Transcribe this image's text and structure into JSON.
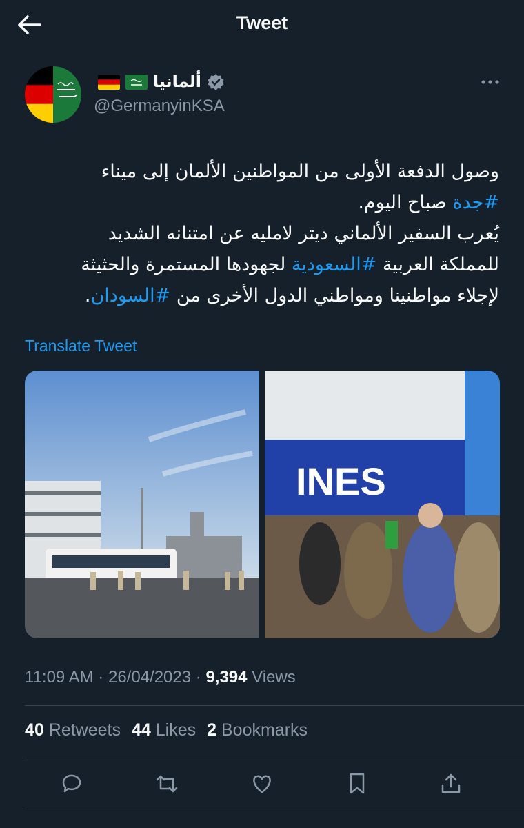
{
  "header": {
    "title": "Tweet",
    "back_icon": "arrow-left-icon"
  },
  "author": {
    "display_name": "ألمانيا",
    "handle": "@GermanyinKSA",
    "flags": [
      "germany-flag-icon",
      "saudi-arabia-flag-icon"
    ],
    "verified_icon": "verified-badge-icon"
  },
  "tweet": {
    "lines": [
      [
        {
          "t": "وصول الدفعة الأولى من المواطنين الألمان إلى ميناء"
        }
      ],
      [
        {
          "t": "#جدة",
          "link": true
        },
        {
          "t": " صباح اليوم."
        }
      ],
      [
        {
          "t": "يُعرب السفير الألماني ديتر لامليه عن امتنانه الشديد"
        }
      ],
      [
        {
          "t": "للمملكة العربية "
        },
        {
          "t": "#السعودية",
          "link": true
        },
        {
          "t": " لجهودها المستمرة والحثيثة"
        }
      ],
      [
        {
          "t": "لإجلاء مواطنينا ومواطني الدول الأخرى من "
        },
        {
          "t": "#السودان",
          "link": true
        },
        {
          "t": "."
        }
      ]
    ],
    "translate_label": "Translate Tweet",
    "ship_lettering": "INES"
  },
  "meta": {
    "time": "11:09 AM",
    "date": "26/04/2023",
    "views_count": "9,394",
    "views_label": "Views",
    "sep": "·"
  },
  "stats": {
    "retweets": {
      "count": "40",
      "label": "Retweets"
    },
    "likes": {
      "count": "44",
      "label": "Likes"
    },
    "bookmarks": {
      "count": "2",
      "label": "Bookmarks"
    }
  },
  "actions": [
    "reply-icon",
    "retweet-icon",
    "like-icon",
    "bookmark-icon",
    "share-icon"
  ],
  "colors": {
    "background": "#15202b",
    "accent": "#1d9bf0",
    "muted": "#8b98a5",
    "text": "#f7f9f9"
  }
}
